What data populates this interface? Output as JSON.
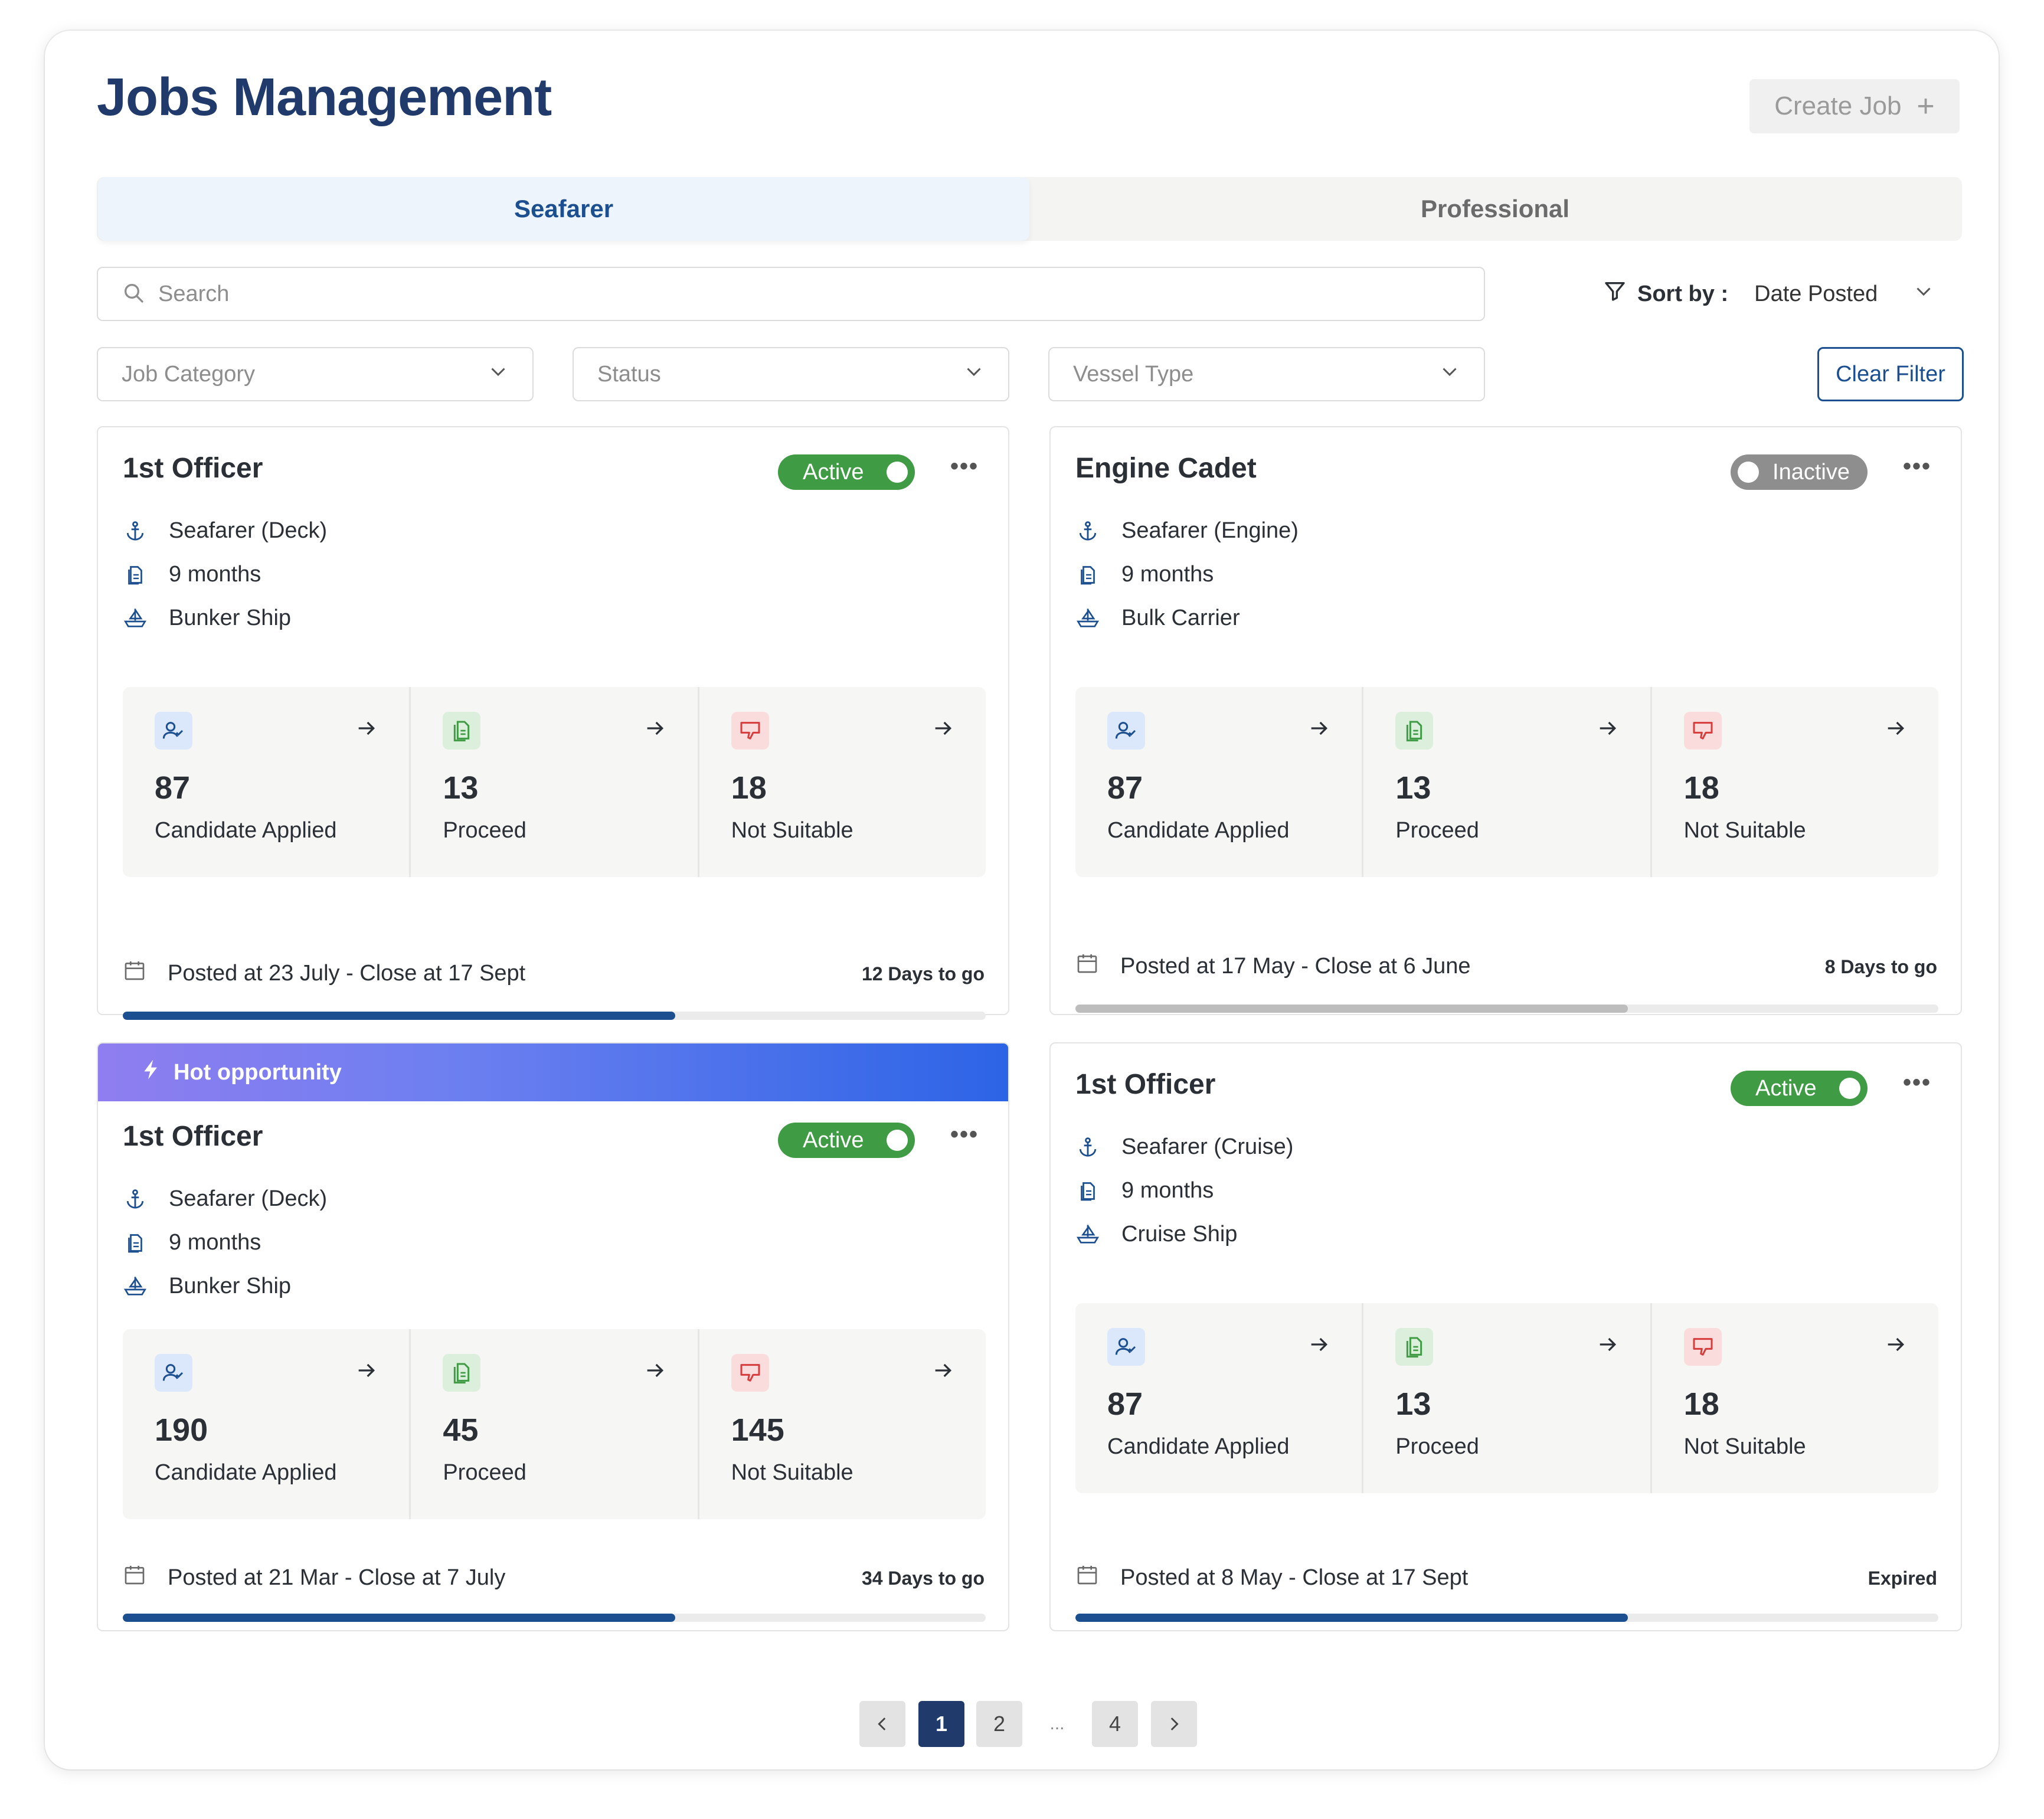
{
  "header": {
    "title": "Jobs Management",
    "create_label": "Create Job",
    "create_icon": "plus-icon"
  },
  "tabs": [
    {
      "label": "Seafarer",
      "active": true
    },
    {
      "label": "Professional",
      "active": false
    }
  ],
  "search": {
    "placeholder": "Search",
    "value": ""
  },
  "sort": {
    "label": "Sort by :",
    "value": "Date Posted"
  },
  "filters": {
    "job_category": "Job Category",
    "status": "Status",
    "vessel_type": "Vessel Type",
    "clear_label": "Clear Filter"
  },
  "colors": {
    "brand": "#1f3a6b",
    "active": "#3f9b44",
    "inactive": "#8e8e8e",
    "progress_blue": "#1c4f8f",
    "progress_gray": "#bdbdbd"
  },
  "cards": [
    {
      "title": "1st Officer",
      "status": "Active",
      "hot": false,
      "category": "Seafarer (Deck)",
      "duration": "9 months",
      "vessel": "Bunker Ship",
      "stats": [
        {
          "value": "87",
          "label": "Candidate Applied"
        },
        {
          "value": "13",
          "label": "Proceed"
        },
        {
          "value": "18",
          "label": "Not Suitable"
        }
      ],
      "posted": "Posted at 23 July - Close at 17 Sept",
      "countdown": "12 Days to go",
      "progress": 0.64
    },
    {
      "title": "Engine Cadet",
      "status": "Inactive",
      "hot": false,
      "category": "Seafarer (Engine)",
      "duration": "9 months",
      "vessel": "Bulk Carrier",
      "stats": [
        {
          "value": "87",
          "label": "Candidate Applied"
        },
        {
          "value": "13",
          "label": "Proceed"
        },
        {
          "value": "18",
          "label": "Not Suitable"
        }
      ],
      "posted": "Posted  at 17 May - Close at 6 June",
      "countdown": "8 Days to go",
      "progress": 0.64
    },
    {
      "title": "1st Officer",
      "status": "Active",
      "hot": true,
      "hot_label": "Hot opportunity",
      "category": "Seafarer (Deck)",
      "duration": "9 months",
      "vessel": "Bunker Ship",
      "stats": [
        {
          "value": "190",
          "label": "Candidate Applied"
        },
        {
          "value": "45",
          "label": "Proceed"
        },
        {
          "value": "145",
          "label": "Not Suitable"
        }
      ],
      "posted": "Posted  at 21 Mar - Close at 7 July",
      "countdown": "34 Days to go",
      "progress": 0.64
    },
    {
      "title": "1st Officer",
      "status": "Active",
      "hot": false,
      "category": "Seafarer (Cruise)",
      "duration": "9 months",
      "vessel": "Cruise Ship",
      "stats": [
        {
          "value": "87",
          "label": "Candidate Applied"
        },
        {
          "value": "13",
          "label": "Proceed"
        },
        {
          "value": "18",
          "label": "Not Suitable"
        }
      ],
      "posted": "Posted  at 8 May - Close at 17 Sept",
      "countdown": "Expired",
      "progress": 0.64
    }
  ],
  "pagination": {
    "pages": [
      "1",
      "2",
      "...",
      "4"
    ],
    "current": "1"
  }
}
